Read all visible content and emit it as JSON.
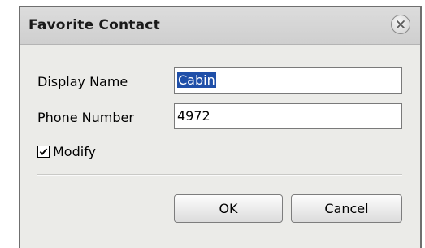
{
  "dialog": {
    "title": "Favorite Contact",
    "close_icon": "close-circle-icon"
  },
  "fields": {
    "display_name_label": "Display Name",
    "display_name_value": "Cabin",
    "phone_number_label": "Phone Number",
    "phone_number_value": "4972"
  },
  "modify": {
    "label": "Modify",
    "checked": true
  },
  "buttons": {
    "ok_label": "OK",
    "cancel_label": "Cancel"
  }
}
